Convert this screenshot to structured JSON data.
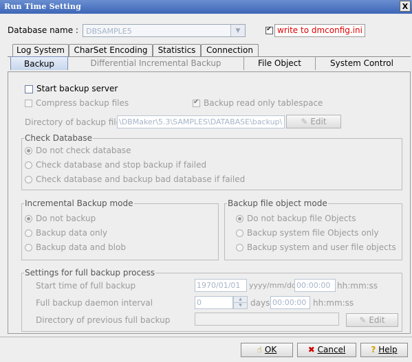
{
  "window": {
    "title": "Run Time Setting",
    "close_label": "X"
  },
  "database": {
    "label": "Database name :",
    "value": "DBSAMPLE5",
    "write_label": "write to dmconfig.ini",
    "write_checked": true
  },
  "tabs_row1": [
    "Log System",
    "CharSet Encoding",
    "Statistics",
    "Connection"
  ],
  "tabs_row2": [
    "Backup",
    "Differential Incremental Backup",
    "File Object",
    "System Control"
  ],
  "backup": {
    "start_server": "Start backup server",
    "compress": "Compress backup files",
    "readonly_ts": "Backup read only tablespace",
    "dir_label": "Directory of backup files",
    "dir_value": "\\DBMaker\\5.3\\SAMPLES\\DATABASE\\backup\\",
    "edit_label": "Edit"
  },
  "check_db": {
    "title": "Check Database",
    "options": [
      "Do not check database",
      "Check database and stop backup if failed",
      "Check database and backup bad database if failed"
    ]
  },
  "incr_mode": {
    "title": "Incremental Backup mode",
    "options": [
      "Do not backup",
      "Backup data only",
      "Backup data and blob"
    ]
  },
  "file_obj_mode": {
    "title": "Backup file object mode",
    "options": [
      "Do not backup file Objects",
      "Backup system file Objects only",
      "Backup system and user file objects"
    ]
  },
  "full_backup": {
    "title": "Settings for full backup process",
    "start_label": "Start time of full backup",
    "date_value": "1970/01/01",
    "date_fmt": "yyyy/mm/dd",
    "time_value": "00:00:00",
    "time_fmt": "hh:mm:ss",
    "interval_label": "Full backup daemon interval",
    "interval_value": "0",
    "days_label": "days",
    "interval_time": "00:00:00",
    "interval_fmt": "hh:mm:ss",
    "prev_dir_label": "Directory of previous full backup",
    "prev_dir_value": "",
    "edit_label": "Edit"
  },
  "buttons": {
    "ok": "OK",
    "cancel": "Cancel",
    "help": "Help"
  }
}
